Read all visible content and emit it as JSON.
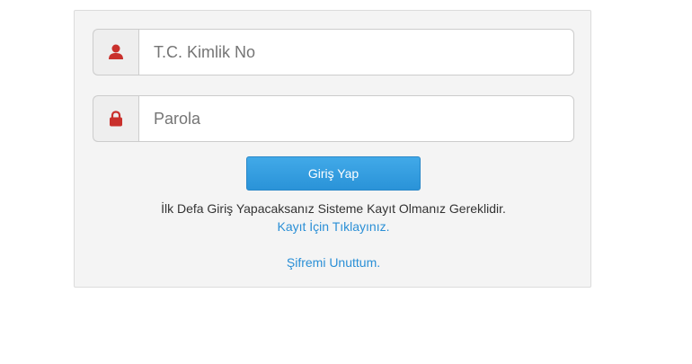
{
  "login": {
    "username_placeholder": "T.C. Kimlik No",
    "password_placeholder": "Parola",
    "username_icon": "user-icon",
    "password_icon": "lock-icon",
    "submit_label": "Giriş Yap",
    "notice_text": "İlk Defa Giriş Yapacaksanız Sisteme Kayıt Olmanız Gereklidir.",
    "register_link": "Kayıt İçin Tıklayınız.",
    "forgot_link": "Şifremi Unuttum."
  },
  "colors": {
    "accent": "#2a93d8",
    "icon": "#c9302c",
    "panel_background": "#f4f4f4",
    "link": "#2a8fd6"
  }
}
